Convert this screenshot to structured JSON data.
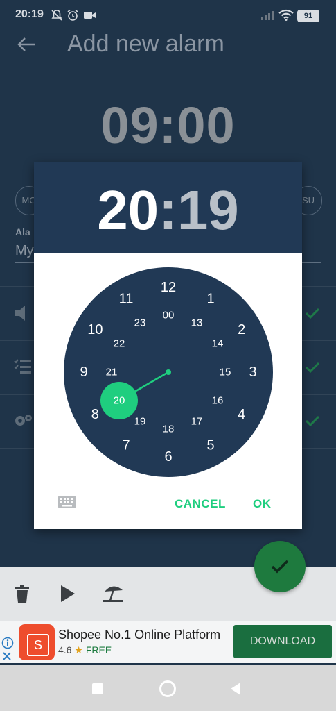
{
  "status_bar": {
    "time": "20:19",
    "battery": "91",
    "icons": [
      "muted-notifications-icon",
      "alarm-clock-icon",
      "video-camera-icon",
      "signal-icon",
      "wifi-icon",
      "battery-icon"
    ]
  },
  "app": {
    "title": "Add new alarm",
    "time": "09:00",
    "day_chip_left": "MO",
    "day_chip_right": "SU",
    "alarm_label": "Ala",
    "alarm_name": "My"
  },
  "dialog": {
    "hour": "20",
    "colon": ":",
    "minute": "19",
    "cancel": "CANCEL",
    "ok": "OK",
    "selected_hour": "20",
    "outer_hours": [
      "12",
      "1",
      "2",
      "3",
      "4",
      "5",
      "6",
      "7",
      "8",
      "9",
      "10",
      "11"
    ],
    "inner_hours": [
      "00",
      "13",
      "14",
      "15",
      "16",
      "17",
      "18",
      "19",
      "20",
      "21",
      "22",
      "23"
    ]
  },
  "ad": {
    "title": "Shopee No.1 Online Platform",
    "rating": "4.6",
    "price": "FREE",
    "download": "DOWNLOAD",
    "logo_letter": "S"
  },
  "colors": {
    "accent": "#1fce7f",
    "dialog_header": "#213955",
    "clock_face": "#213955",
    "background": "#1f3449"
  }
}
